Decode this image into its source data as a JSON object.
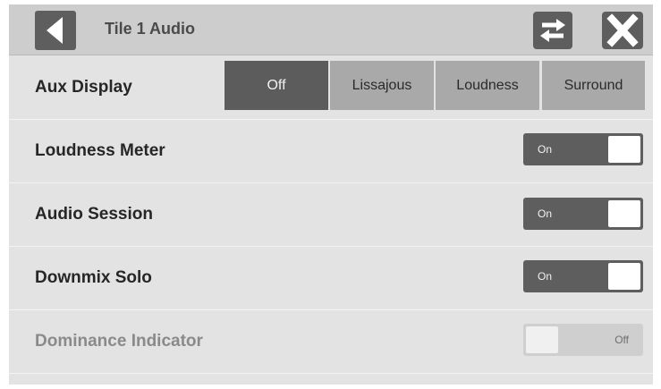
{
  "header": {
    "title": "Tile 1 Audio",
    "back_icon": "back-arrow-icon",
    "swap_icon": "swap-arrows-icon",
    "close_icon": "close-x-icon"
  },
  "aux_display": {
    "label": "Aux Display",
    "options": [
      "Off",
      "Lissajous",
      "Loudness",
      "Surround"
    ],
    "selected": "Off"
  },
  "settings": [
    {
      "label": "Loudness Meter",
      "state": "On",
      "enabled": true
    },
    {
      "label": "Audio Session",
      "state": "On",
      "enabled": true
    },
    {
      "label": "Downmix Solo",
      "state": "On",
      "enabled": true
    },
    {
      "label": "Dominance Indicator",
      "state": "Off",
      "enabled": false
    }
  ],
  "colors": {
    "panel_bg": "#e3e3e3",
    "titlebar_bg": "#cdcdcd",
    "button_dark": "#5e5e5e",
    "segment_unselected": "#a9a9a9",
    "segment_selected": "#5c5c5c"
  }
}
